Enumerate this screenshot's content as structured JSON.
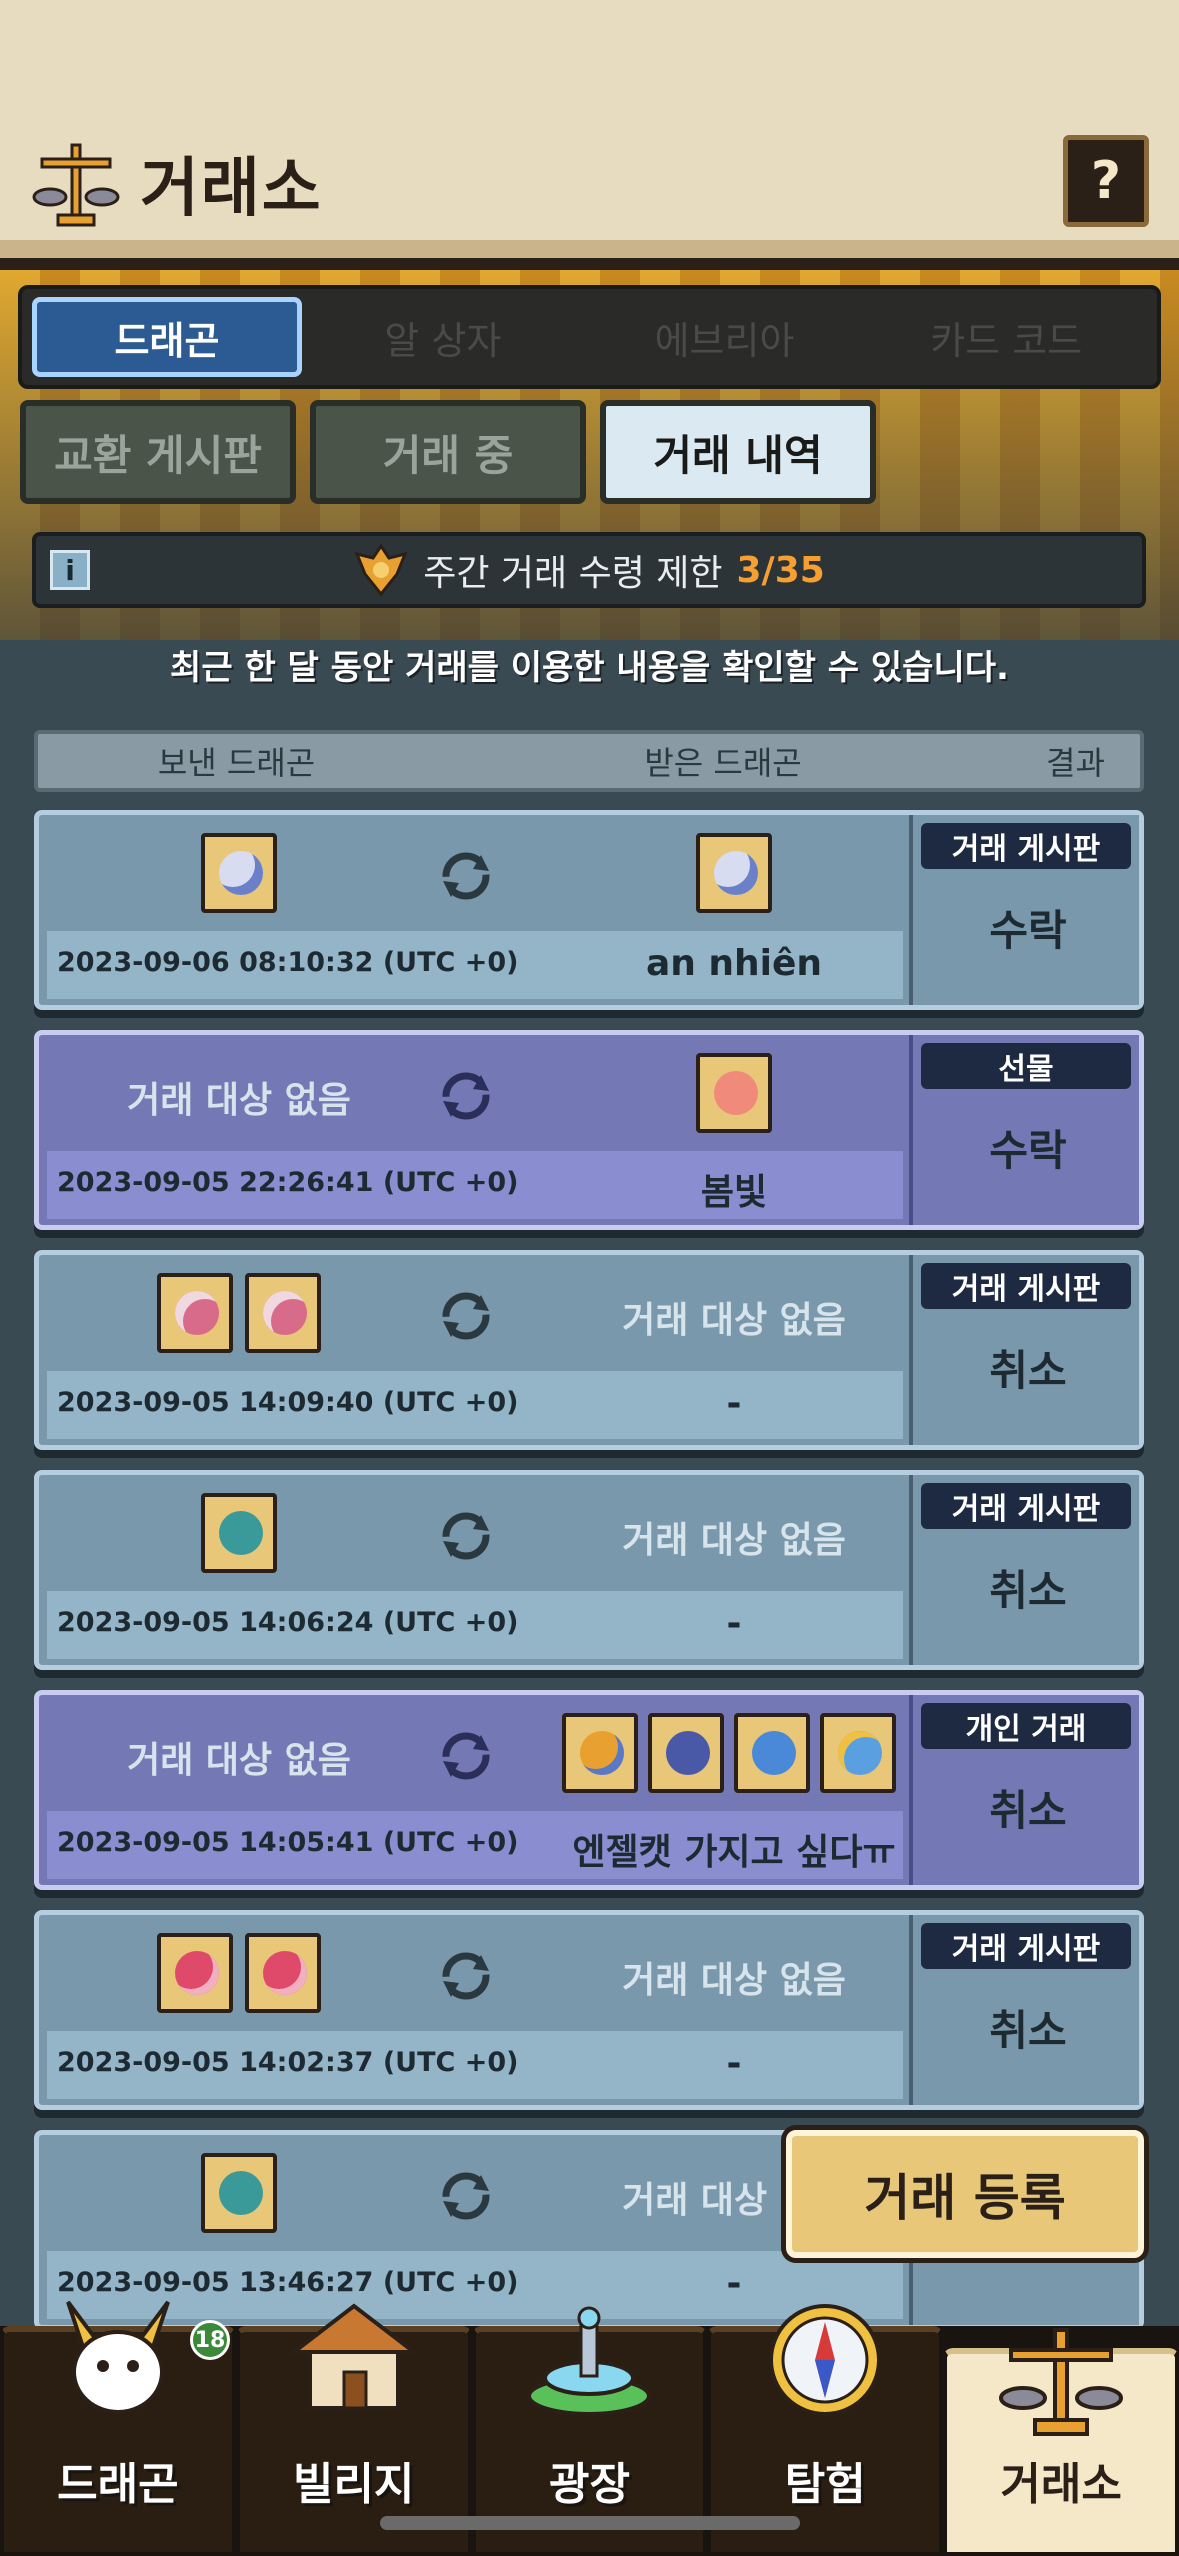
{
  "header": {
    "title": "거래소",
    "help_label": "?"
  },
  "main_tabs": [
    "드래곤",
    "알 상자",
    "에브리아",
    "카드 코드"
  ],
  "sub_tabs": [
    "교환 게시판",
    "거래 중",
    "거래 내역"
  ],
  "notice": {
    "info_label": "i",
    "text": "주간 거래 수령 제한",
    "count": "3/35"
  },
  "description": "최근 한 달 동안 거래를 이용한 내용을 확인할 수 있습니다.",
  "columns": {
    "sent": "보낸 드래곤",
    "received": "받은 드래곤",
    "result": "결과"
  },
  "empty_target": "거래 대상 없음",
  "rows": [
    {
      "timestamp": "2023-09-06 08:10:32 (UTC +0)",
      "recv_name": "an nhiên",
      "category": "거래 게시판",
      "result": "수락"
    },
    {
      "timestamp": "2023-09-05 22:26:41 (UTC +0)",
      "recv_name": "봄빛",
      "category": "선물",
      "result": "수락"
    },
    {
      "timestamp": "2023-09-05 14:09:40 (UTC +0)",
      "recv_name": "-",
      "category": "거래 게시판",
      "result": "취소"
    },
    {
      "timestamp": "2023-09-05 14:06:24 (UTC +0)",
      "recv_name": "-",
      "category": "거래 게시판",
      "result": "취소"
    },
    {
      "timestamp": "2023-09-05 14:05:41 (UTC +0)",
      "recv_name": "엔젤캣 가지고 싶다ㅠ",
      "category": "개인 거래",
      "result": "취소"
    },
    {
      "timestamp": "2023-09-05 14:02:37 (UTC +0)",
      "recv_name": "-",
      "category": "거래 게시판",
      "result": "취소"
    },
    {
      "timestamp": "2023-09-05 13:46:27 (UTC +0)",
      "recv_name": "-",
      "category": "",
      "result": ""
    }
  ],
  "register_button": "거래 등록",
  "bottom_nav": [
    {
      "label": "드래곤",
      "badge": "18"
    },
    {
      "label": "빌리지"
    },
    {
      "label": "광장"
    },
    {
      "label": "탐험"
    },
    {
      "label": "거래소"
    }
  ],
  "colors": {
    "accent": "#2c5a92",
    "count": "#f5a030",
    "row": "#7a98ac",
    "gift_row": "#7478b4"
  }
}
